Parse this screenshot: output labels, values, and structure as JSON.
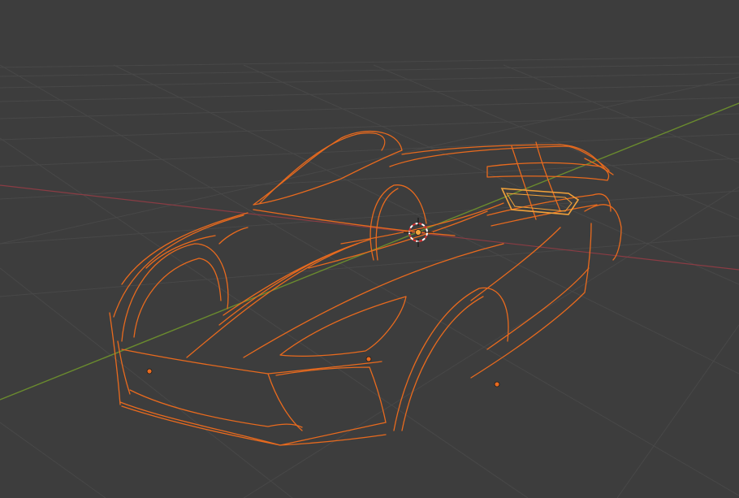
{
  "viewport": {
    "background": "#3d3d3d",
    "grid_color": "#484848",
    "x_axis_color": "#8a3c44",
    "y_axis_color": "#6a8b2e",
    "object_outline_color": "#e86a1e",
    "active_outline_color": "#f2a23a",
    "selected_object_kind": "curve",
    "cursor_icon": "3d-cursor-icon",
    "origin_icon": "object-origin-icon"
  }
}
